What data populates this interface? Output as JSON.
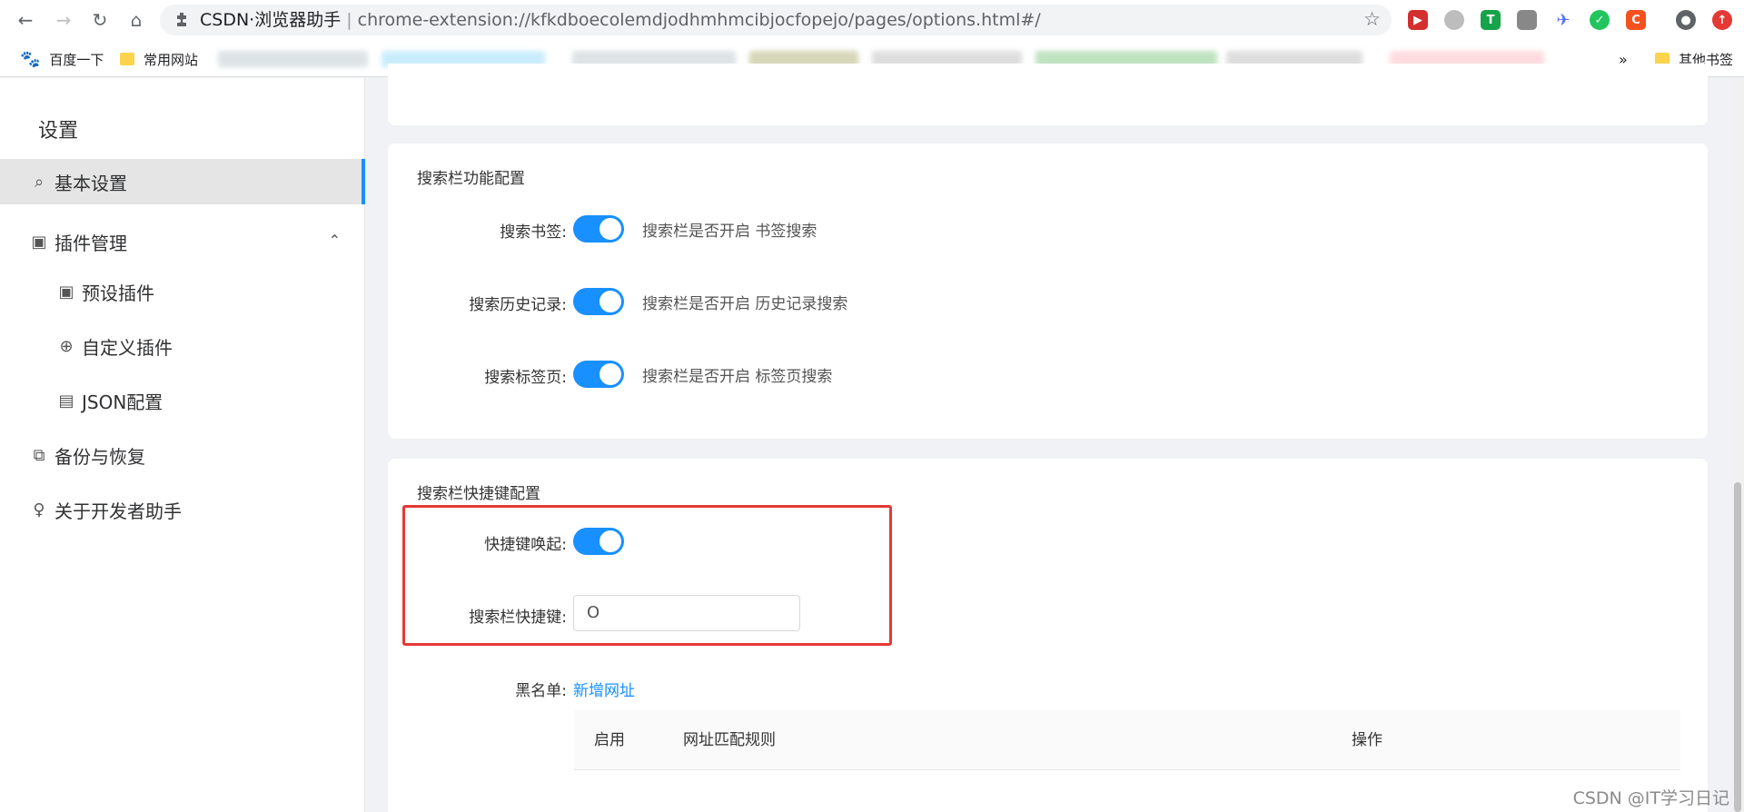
{
  "browser": {
    "omnibox_title": "CSDN·浏览器助手",
    "omnibox_sep": "|",
    "omnibox_url": "chrome-extension://kfkdboecolemdjodhmhmcibjocfopejo/pages/options.html#/",
    "bookmarks": [
      {
        "label": "百度一下"
      },
      {
        "label": "常用网站"
      }
    ],
    "bookmarks_more": "»",
    "other_bookmarks": "其他书签",
    "extension_colors": [
      "#d32f2f",
      "#bdbdbd",
      "#16a34a",
      "#888888",
      "#4f6ef7",
      "#22c55e",
      "#f4511e",
      "#e53935"
    ]
  },
  "sidebar": {
    "title": "设置",
    "items": [
      {
        "label": "基本设置",
        "icon": "search-icon"
      },
      {
        "label": "插件管理",
        "icon": "plugin-box-icon"
      },
      {
        "label": "预设插件",
        "icon": "plugin-box-icon"
      },
      {
        "label": "自定义插件",
        "icon": "globe-icon"
      },
      {
        "label": "JSON配置",
        "icon": "json-file-icon"
      },
      {
        "label": "备份与恢复",
        "icon": "backup-icon"
      },
      {
        "label": "关于开发者助手",
        "icon": "bulb-icon"
      }
    ]
  },
  "search_config": {
    "title": "搜索栏功能配置",
    "rows": [
      {
        "label": "搜索书签:",
        "enabled": true,
        "desc": "搜索栏是否开启 书签搜索"
      },
      {
        "label": "搜索历史记录:",
        "enabled": true,
        "desc": "搜索栏是否开启 历史记录搜索"
      },
      {
        "label": "搜索标签页:",
        "enabled": true,
        "desc": "搜索栏是否开启 标签页搜索"
      }
    ]
  },
  "shortcut_config": {
    "title": "搜索栏快捷键配置",
    "wake_label": "快捷键唤起:",
    "wake_enabled": true,
    "key_label": "搜索栏快捷键:",
    "key_value": "O",
    "blacklist_label": "黑名单:",
    "add_link": "新增网址",
    "table_headers": [
      "启用",
      "网址匹配规则",
      "操作"
    ]
  },
  "watermark": "CSDN @IT学习日记",
  "colors": {
    "accent": "#1890ff",
    "highlight": "#e53935"
  }
}
